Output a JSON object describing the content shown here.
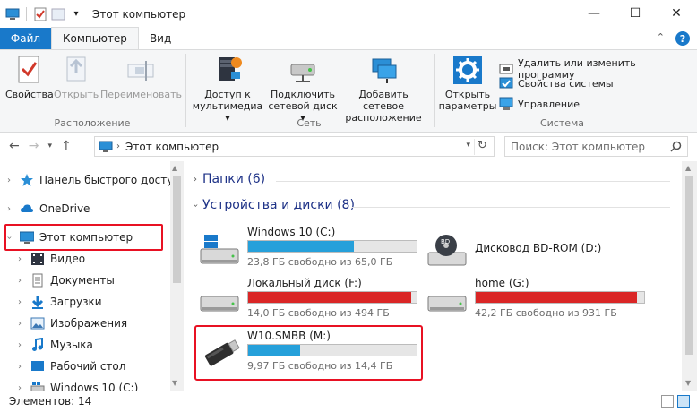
{
  "window": {
    "title": "Этот компьютер"
  },
  "tabs": {
    "file": "Файл",
    "computer": "Компьютер",
    "view": "Вид"
  },
  "ribbon": {
    "location": {
      "label": "Расположение",
      "properties": "Свойства",
      "open": "Открыть",
      "rename": "Переименовать"
    },
    "network": {
      "label": "Сеть",
      "media_l1": "Доступ к",
      "media_l2": "мультимедиа",
      "map_l1": "Подключить",
      "map_l2": "сетевой диск",
      "add_l1": "Добавить сетевое",
      "add_l2": "расположение"
    },
    "system": {
      "label": "Система",
      "open_l1": "Открыть",
      "open_l2": "параметры",
      "uninstall": "Удалить или изменить программу",
      "sysprops": "Свойства системы",
      "manage": "Управление"
    }
  },
  "address": {
    "path": "Этот компьютер",
    "search_placeholder": "Поиск: Этот компьютер"
  },
  "nav": {
    "quick": "Панель быстрого доступа",
    "onedrive": "OneDrive",
    "thispc": "Этот компьютер",
    "video": "Видео",
    "docs": "Документы",
    "downloads": "Загрузки",
    "images": "Изображения",
    "music": "Музыка",
    "desktop": "Рабочий стол",
    "win10": "Windows 10 (C:)"
  },
  "content": {
    "folders": "Папки (6)",
    "devices": "Устройства и диски (8)",
    "drives": [
      {
        "name": "Windows 10 (C:)",
        "info": "23,8 ГБ свободно из 65,0 ГБ",
        "used": 0.63,
        "color": "#26a0da"
      },
      {
        "name": "Дисковод BD-ROM (D:)",
        "info": "",
        "used": 0,
        "color": "#26a0da"
      },
      {
        "name": "Локальный диск (F:)",
        "info": "14,0 ГБ свободно из 494 ГБ",
        "used": 0.97,
        "color": "#da2626"
      },
      {
        "name": "home (G:)",
        "info": "42,2 ГБ свободно из 931 ГБ",
        "used": 0.955,
        "color": "#da2626"
      },
      {
        "name": "W10.SMBB (M:)",
        "info": "9,97 ГБ свободно из 14,4 ГБ",
        "used": 0.31,
        "color": "#26a0da"
      }
    ]
  },
  "status": {
    "items": "Элементов: 14"
  }
}
